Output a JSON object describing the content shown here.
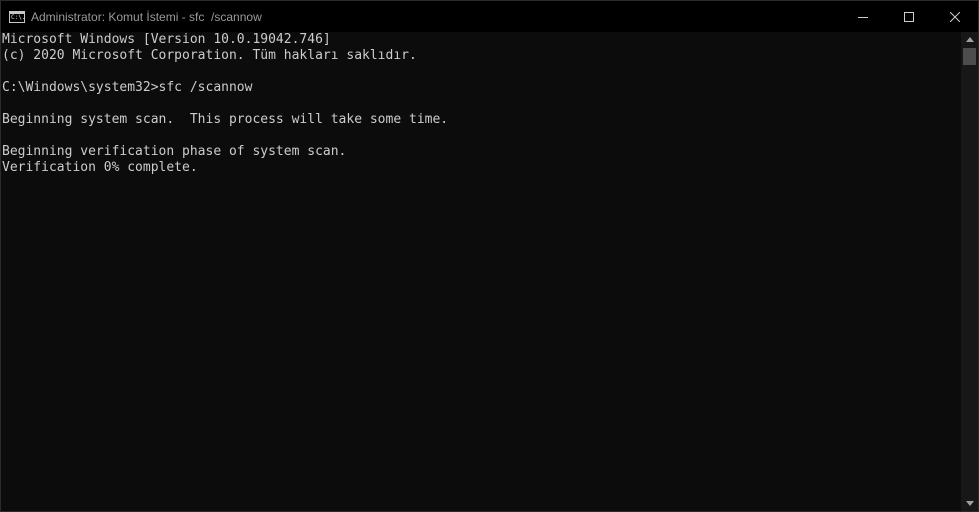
{
  "window": {
    "title": "Administrator: Komut İstemi - sfc  /scannow",
    "icon_glyph": "C:\\.",
    "icons": {
      "app": "cmd-icon",
      "minimize": "minimize-icon",
      "maximize": "maximize-icon",
      "close": "close-icon",
      "scroll_up": "chevron-up-icon",
      "scroll_down": "chevron-down-icon"
    }
  },
  "console": {
    "lines": [
      "Microsoft Windows [Version 10.0.19042.746]",
      "(c) 2020 Microsoft Corporation. Tüm hakları saklıdır.",
      "",
      "C:\\Windows\\system32>sfc /scannow",
      "",
      "Beginning system scan.  This process will take some time.",
      "",
      "Beginning verification phase of system scan.",
      "Verification 0% complete."
    ]
  },
  "colors": {
    "background": "#0c0c0c",
    "foreground": "#cccccc",
    "titlebar": "#000000"
  }
}
